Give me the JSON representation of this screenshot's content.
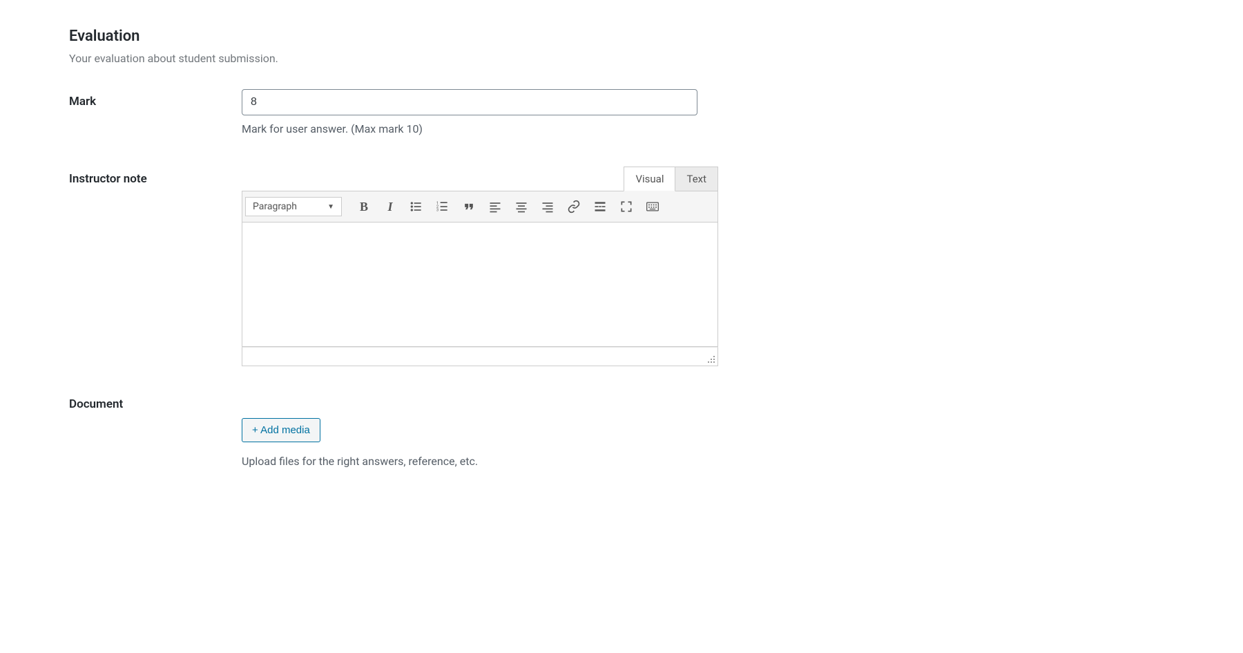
{
  "section": {
    "title": "Evaluation",
    "description": "Your evaluation about student submission."
  },
  "mark": {
    "label": "Mark",
    "value": "8",
    "help": "Mark for user answer. (Max mark 10)"
  },
  "instructor_note": {
    "label": "Instructor note",
    "tabs": {
      "visual": "Visual",
      "text": "Text"
    },
    "block_format": "Paragraph",
    "content": ""
  },
  "document": {
    "label": "Document",
    "add_media": "+ Add media",
    "help": "Upload files for the right answers, reference, etc."
  }
}
